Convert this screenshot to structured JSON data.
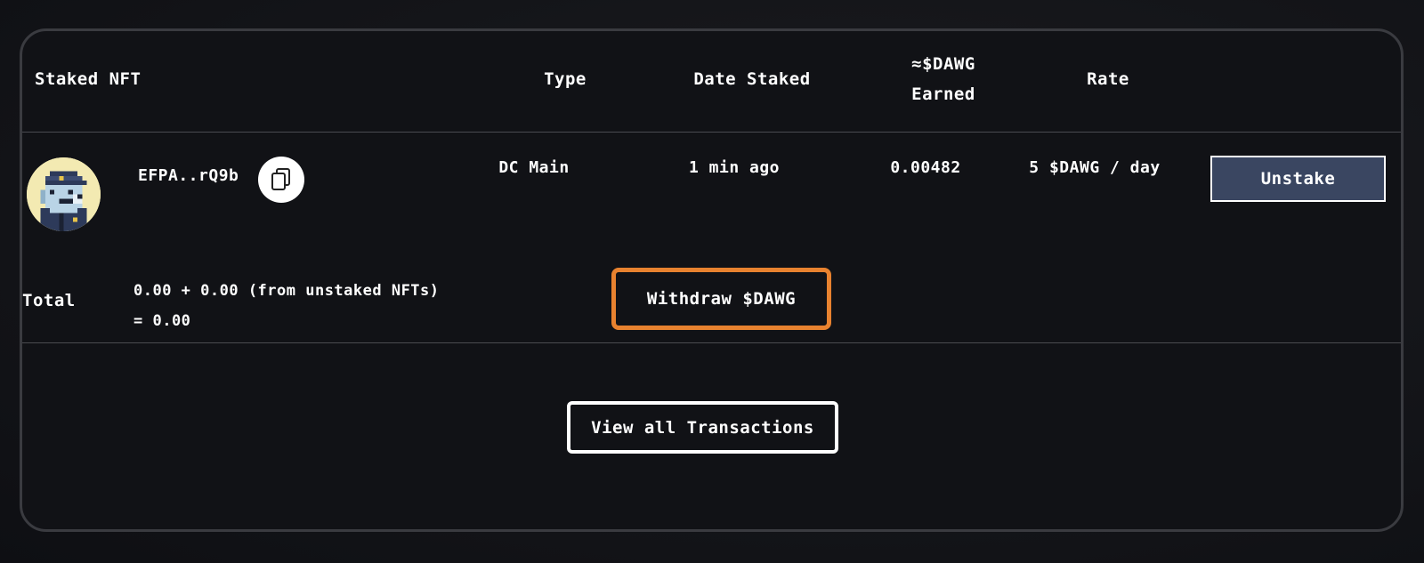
{
  "table": {
    "headers": {
      "staked_nft": "Staked NFT",
      "type": "Type",
      "date_staked": "Date Staked",
      "earned_line1": "≈$DAWG",
      "earned_line2": "Earned",
      "rate": "Rate"
    },
    "rows": [
      {
        "nft_id": "EFPA..rQ9b",
        "type": "DC Main",
        "date_staked": "1 min ago",
        "earned": "0.00482",
        "rate": "5 $DAWG / day",
        "action_label": "Unstake"
      }
    ]
  },
  "total": {
    "label": "Total",
    "line1": "0.00 + 0.00 (from unstaked NFTs)",
    "line2": "= 0.00",
    "withdraw_label": "Withdraw $DAWG"
  },
  "footer": {
    "view_all_label": "View all Transactions"
  },
  "icons": {
    "copy": "copy-icon",
    "avatar": "nft-avatar"
  },
  "colors": {
    "accent_orange": "#e8822f",
    "button_blue": "#3a4661",
    "avatar_bg": "#f3eab2"
  }
}
